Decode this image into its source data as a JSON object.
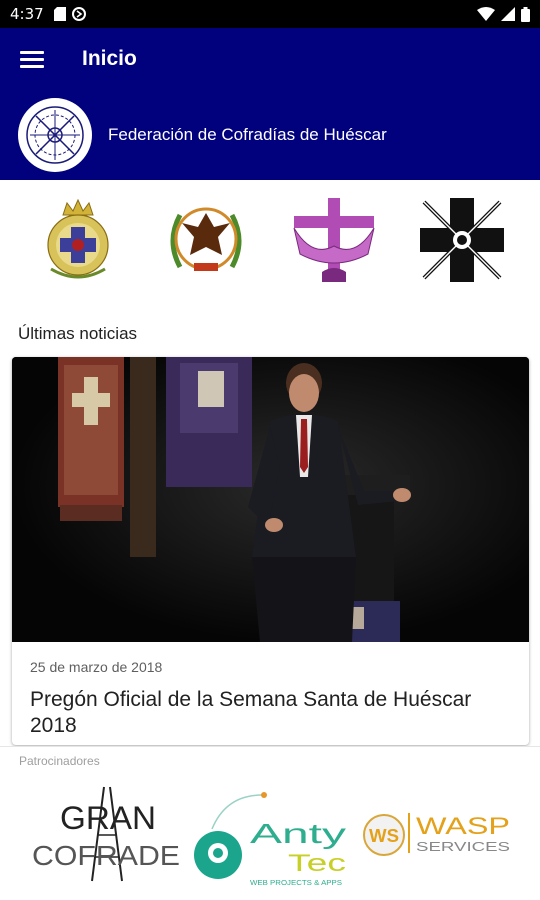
{
  "status_bar": {
    "time": "4:37"
  },
  "toolbar": {
    "title": "Inicio",
    "menu_icon": "hamburger-menu-icon"
  },
  "organization": {
    "name": "Federación de Cofradías de Huéscar"
  },
  "colors": {
    "app_bar": "#01017e",
    "status_bar": "#000000",
    "accent_purple": "#a23ca8"
  },
  "news": {
    "section_title": "Últimas noticias",
    "items": [
      {
        "date": "25 de marzo de 2018",
        "title": "Pregón Oficial de la Semana Santa de Huéscar 2018"
      }
    ]
  },
  "sponsors": {
    "label": "Patrocinadores",
    "items": [
      {
        "line1": "GRAN",
        "line2": "COFRADE"
      },
      {
        "line1": "Anty",
        "line2": "Tec",
        "tagline": "WEB PROJECTS & APPS"
      },
      {
        "badge": "WS",
        "line1": "WASP",
        "line2": "SERVICES"
      }
    ]
  }
}
